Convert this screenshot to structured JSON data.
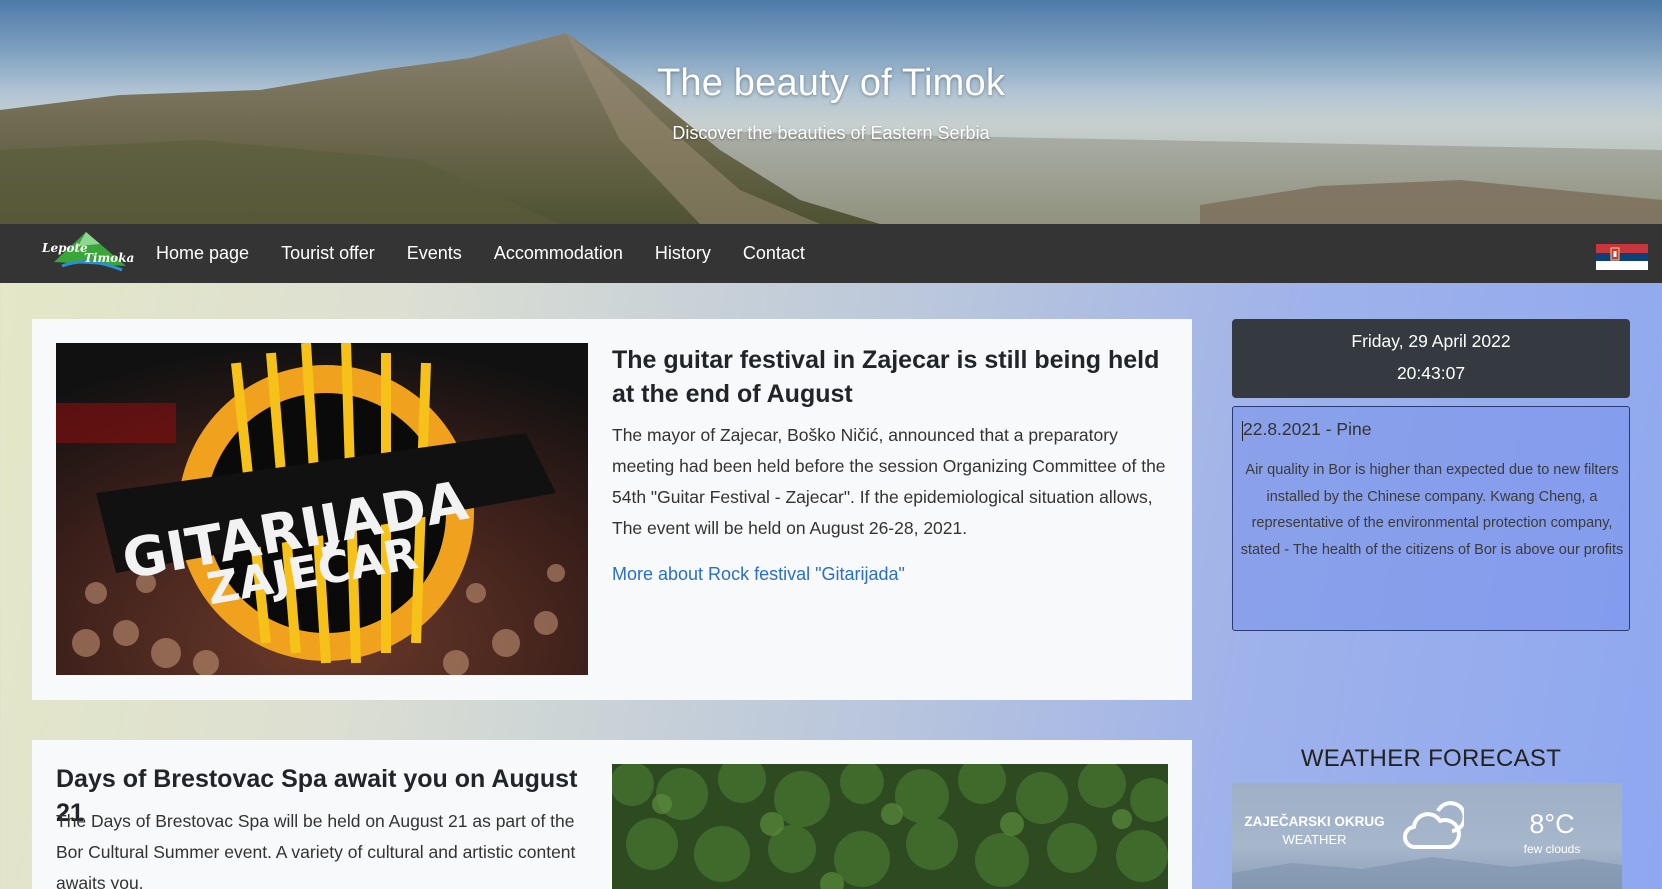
{
  "hero": {
    "title": "The beauty of Timok",
    "subtitle": "Discover the beauties of Eastern Serbia"
  },
  "nav": {
    "logo_text_1": "Lepote",
    "logo_text_2": "Timoka",
    "items": [
      {
        "label": "Home page"
      },
      {
        "label": "Tourist offer"
      },
      {
        "label": "Events"
      },
      {
        "label": "Accommodation"
      },
      {
        "label": "History"
      },
      {
        "label": "Contact"
      }
    ],
    "flag_icon": "serbian-flag-icon"
  },
  "articles": [
    {
      "title": "The guitar festival in Zajecar is still being held at the end of August",
      "text": "The mayor of Zajecar, Boško Ničić, announced that a preparatory meeting had been held before the session Organizing Committee of the 54th \"Guitar Festival - Zajecar\". If the epidemiological situation allows, The event will be held on August 26-28, 2021.",
      "link": "More about Rock festival \"Gitarijada\"",
      "image_text_1": "GITARIJADA",
      "image_text_2": "ZAJEČAR"
    },
    {
      "title": "Days of Brestovac Spa await you on August 21",
      "text": "The Days of Brestovac Spa will be held on August 21 as part of the Bor Cultural Summer event. A variety of cultural and artistic content awaits you."
    }
  ],
  "sidebar": {
    "date": "Friday, 29 April 2022",
    "time": "20:43:07",
    "news": {
      "header": "22.8.2021 - Pine",
      "body": "Air quality in Bor is higher than expected due to new filters installed by the Chinese company. Kwang Cheng, a representative of the environmental protection company, stated - The health of the citizens of Bor is above our profits"
    },
    "weather": {
      "heading": "WEATHER FORECAST",
      "location": "ZAJEČARSKI OKRUG",
      "label": "WEATHER",
      "temperature": "8°C",
      "description": "few clouds",
      "icon": "cloud-icon"
    }
  },
  "colors": {
    "navbar": "#343434",
    "card": "#f8f9fa",
    "link": "#2a6fc4",
    "clock": "#343a40"
  }
}
